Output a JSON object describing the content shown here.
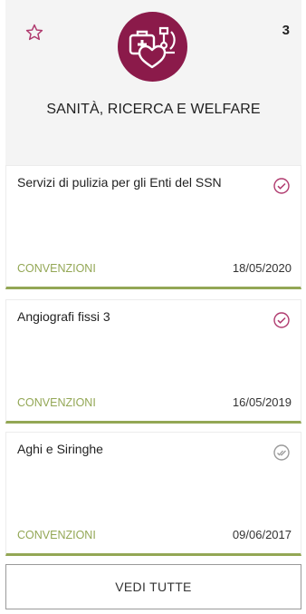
{
  "category": {
    "title": "SANITÀ, RICERCA E WELFARE",
    "count": "3",
    "icon": "medical-kit-heart-microscope-icon",
    "accent_color": "#8b1a4a"
  },
  "favorite": {
    "icon": "star-outline-icon",
    "color": "#b03a6e"
  },
  "cards": [
    {
      "title": "Servizi di pulizia per gli Enti del SSN",
      "type": "CONVENZIONI",
      "date": "18/05/2020",
      "status_icon": "check-circle-icon",
      "status_color": "#b03a6e"
    },
    {
      "title": "Angiografi fissi 3",
      "type": "CONVENZIONI",
      "date": "16/05/2019",
      "status_icon": "check-circle-icon",
      "status_color": "#b03a6e"
    },
    {
      "title": "Aghi e Siringhe",
      "type": "CONVENZIONI",
      "date": "09/06/2017",
      "status_icon": "double-check-circle-icon",
      "status_color": "#9a9a9a"
    }
  ],
  "see_all_label": "VEDI TUTTE",
  "colors": {
    "card_accent": "#93a755",
    "header_bg": "#f4f4f4"
  }
}
